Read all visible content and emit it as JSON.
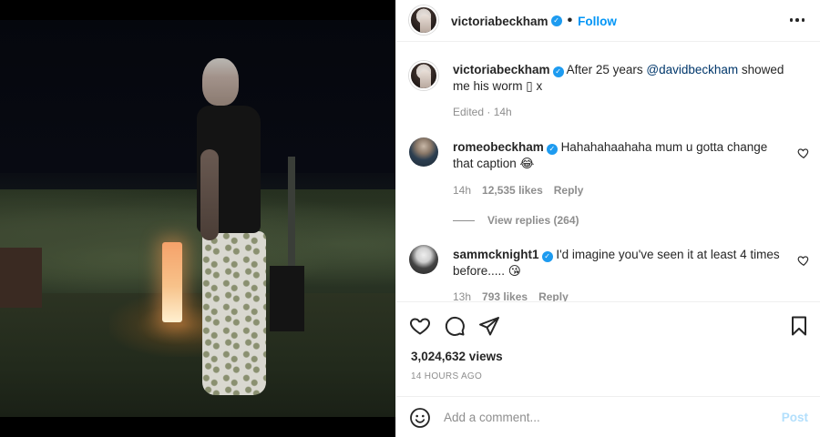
{
  "post": {
    "author": "victoriabeckham",
    "follow_label": "Follow",
    "separator": "•",
    "caption_prefix": "After 25 years ",
    "caption_mention": "@davidbeckham",
    "caption_suffix": " showed me his worm ▯ x",
    "edited": "Edited · 14h"
  },
  "comments": [
    {
      "username": "romeobeckham",
      "text": "Hahahahaahaha mum u gotta change that caption 😂",
      "time": "14h",
      "likes": "12,535 likes",
      "reply": "Reply",
      "view_replies": "View replies (264)"
    },
    {
      "username": "sammcknight1",
      "text": "I'd imagine you've seen it at least 4 times before..... 😘",
      "time": "13h",
      "likes": "793 likes",
      "reply": "Reply"
    }
  ],
  "stats": {
    "views": "3,024,632 views",
    "ago": "14 HOURS AGO"
  },
  "composer": {
    "placeholder": "Add a comment...",
    "post_label": "Post"
  },
  "icons": {
    "like": "heart-icon",
    "comment": "comment-icon",
    "share": "share-icon",
    "save": "bookmark-icon",
    "more": "more-options-icon",
    "emoji": "emoji-icon",
    "verified": "verified-badge-icon"
  },
  "colors": {
    "accent": "#0095f6",
    "verified": "#1d9bf0",
    "muted": "#8e8e8e",
    "post_disabled": "#b2dffc"
  }
}
